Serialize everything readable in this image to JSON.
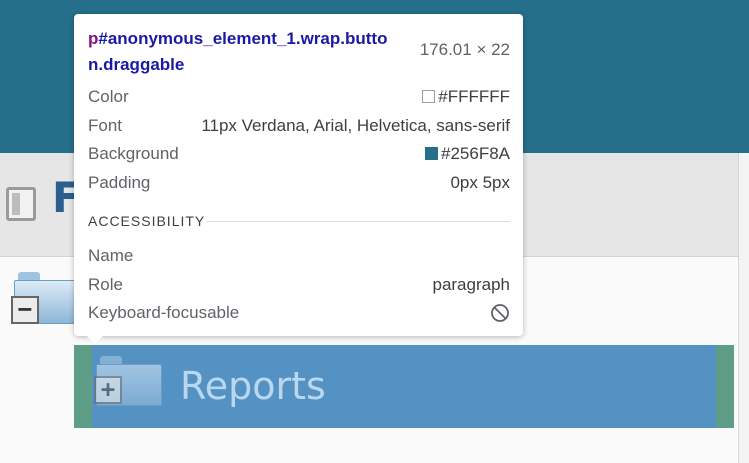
{
  "header": {
    "title": "F"
  },
  "tree": {
    "drag_item_label": "Reports"
  },
  "tooltip": {
    "selector_tag": "p",
    "selector_rest": "#anonymous_element_1.wrap.button.draggable",
    "dimensions": "176.01 × 22",
    "rows": [
      {
        "key": "Color",
        "value": "#FFFFFF"
      },
      {
        "key": "Font",
        "value": "11px Verdana, Arial, Helvetica, sans-serif"
      },
      {
        "key": "Background",
        "value": "#256F8A"
      },
      {
        "key": "Padding",
        "value": "0px 5px"
      }
    ],
    "accessibility": {
      "section_title": "ACCESSIBILITY",
      "rows": [
        {
          "key": "Name",
          "value": ""
        },
        {
          "key": "Role",
          "value": "paragraph"
        },
        {
          "key": "Keyboard-focusable",
          "value": ""
        }
      ]
    }
  },
  "colors": {
    "topbar": "#256F8A",
    "drag_row": "#5592C4",
    "swatch_color": "#FFFFFF",
    "swatch_background": "#256F8A"
  },
  "icons": {
    "header": "toggle-icon",
    "folder": "folder-icon",
    "collapse": "minus-box-icon",
    "expand": "plus-box-icon",
    "not_focusable": "block-icon"
  }
}
